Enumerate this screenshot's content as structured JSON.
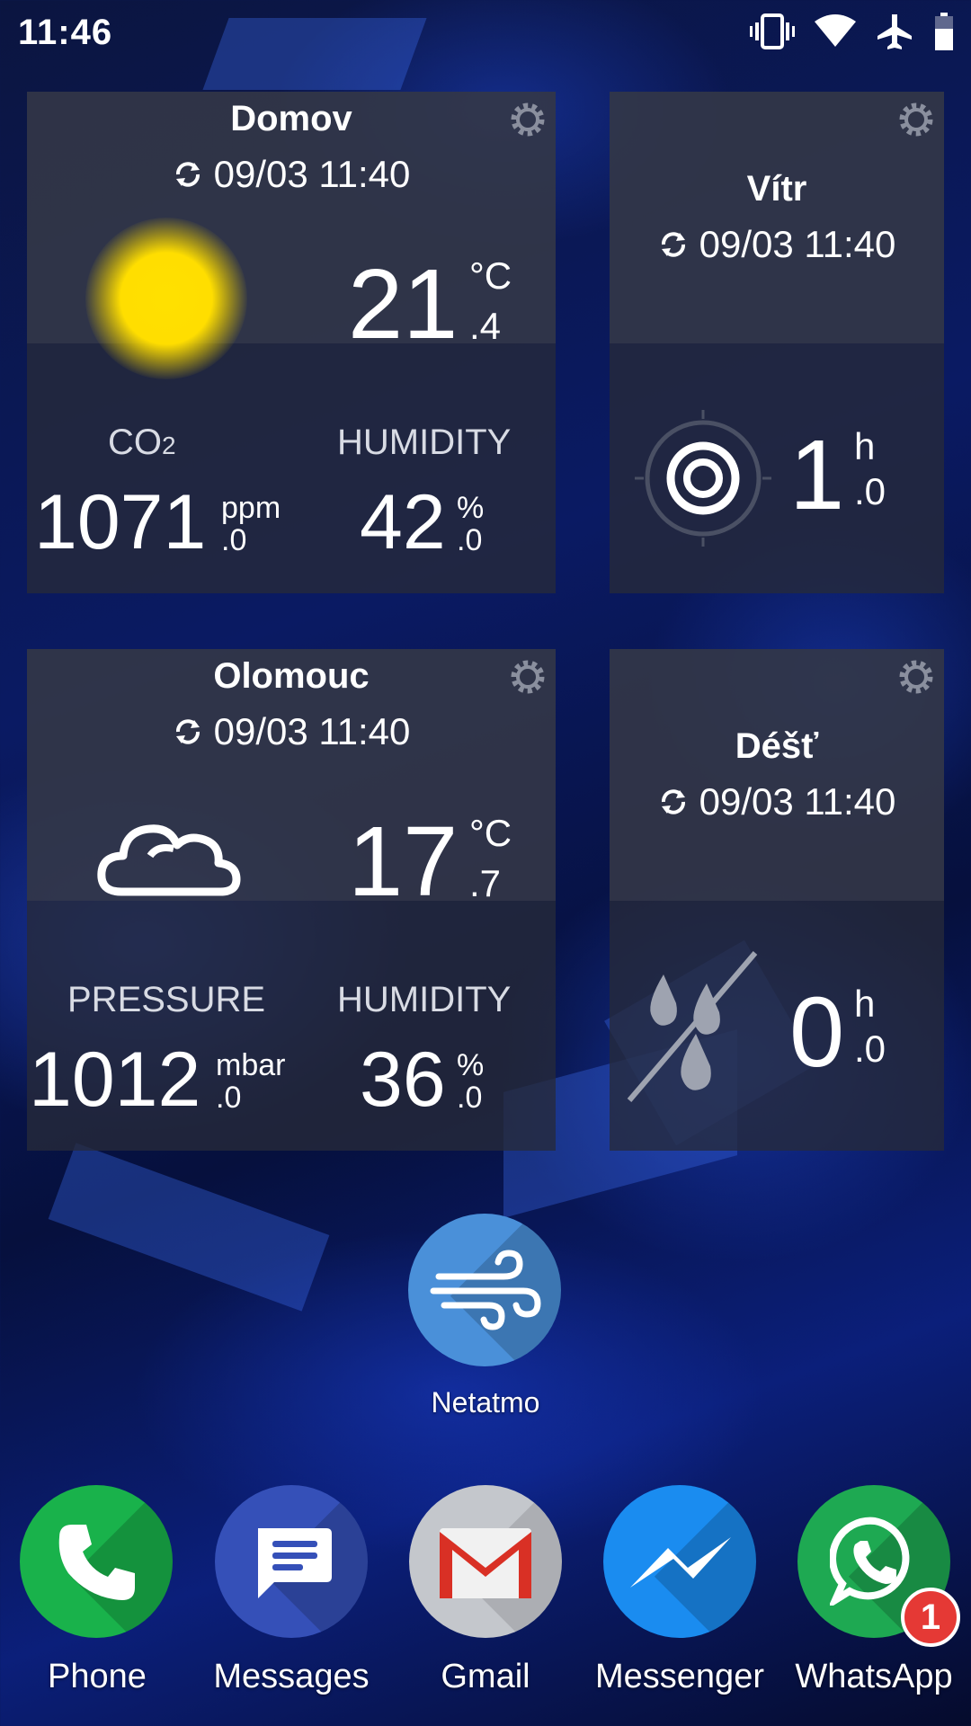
{
  "status_bar": {
    "time": "11:46"
  },
  "widgets": {
    "domov": {
      "title": "Domov",
      "updated": "09/03 11:40",
      "temp_int": "21",
      "temp_dec": ".4",
      "temp_unit": "°C",
      "co2_label_main": "CO",
      "co2_label_sub": "2",
      "co2_int": "1071",
      "co2_dec": ".0",
      "co2_unit": "ppm",
      "humidity_label": "HUMIDITY",
      "humidity_int": "42",
      "humidity_dec": ".0",
      "humidity_unit": "%"
    },
    "vitr": {
      "title": "Vítr",
      "updated": "09/03 11:40",
      "value_int": "1",
      "value_dec": ".0",
      "unit": "h"
    },
    "olomouc": {
      "title": "Olomouc",
      "updated": "09/03 11:40",
      "temp_int": "17",
      "temp_dec": ".7",
      "temp_unit": "°C",
      "pressure_label": "PRESSURE",
      "pressure_int": "1012",
      "pressure_dec": ".0",
      "pressure_unit": "mbar",
      "humidity_label": "HUMIDITY",
      "humidity_int": "36",
      "humidity_dec": ".0",
      "humidity_unit": "%"
    },
    "dest": {
      "title": "Déšť",
      "updated": "09/03 11:40",
      "value_int": "0",
      "value_dec": ".0",
      "unit": "h"
    }
  },
  "home_app": {
    "label": "Netatmo"
  },
  "dock": [
    {
      "label": "Phone"
    },
    {
      "label": "Messages"
    },
    {
      "label": "Gmail"
    },
    {
      "label": "Messenger"
    },
    {
      "label": "WhatsApp",
      "badge": "1"
    }
  ]
}
